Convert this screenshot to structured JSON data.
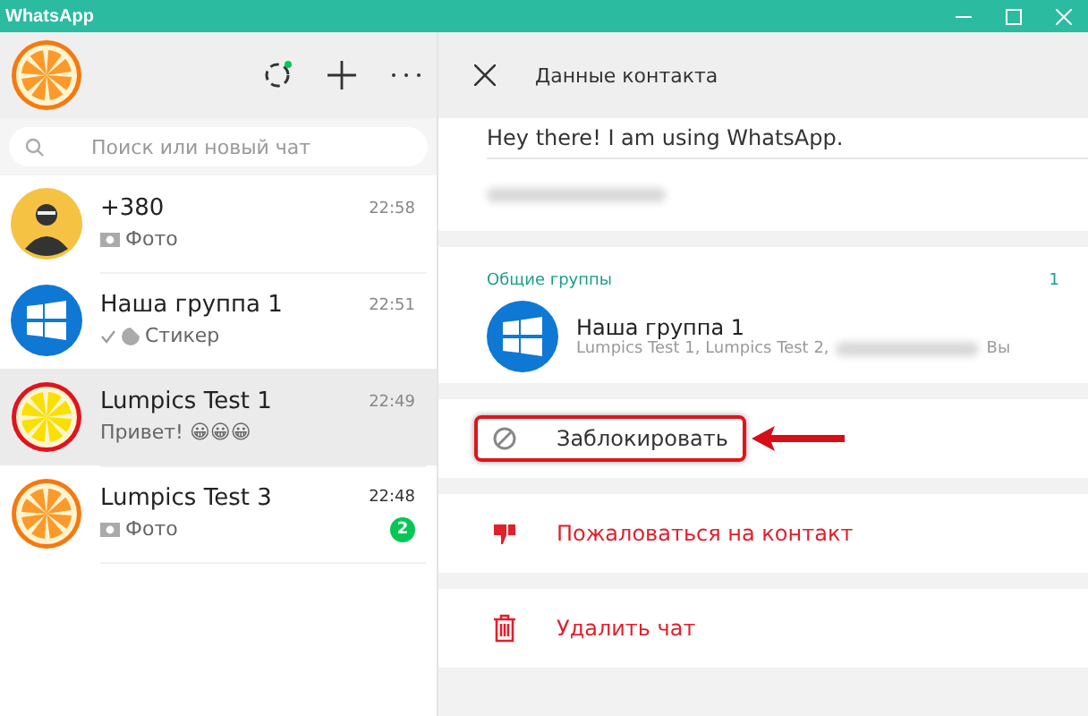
{
  "window": {
    "title": "WhatsApp"
  },
  "sidebar": {
    "search": {
      "placeholder": "Поиск или новый чат"
    },
    "chats": [
      {
        "name": "+380",
        "avatar": {
          "kind": "person"
        },
        "preview_icon": {
          "kind": "photo"
        },
        "preview": "Фото",
        "time": "22:58",
        "selected": false,
        "sent_check": false,
        "bold": false
      },
      {
        "name": "Наша группа 1",
        "avatar": {
          "kind": "windows"
        },
        "preview_icon": {
          "kind": "sticker"
        },
        "preview": "Стикер",
        "time": "22:51",
        "selected": false,
        "sent_check": true,
        "bold": false
      },
      {
        "name": "Lumpics Test 1",
        "avatar": {
          "kind": "lemon"
        },
        "preview": "Привет! 😀😀😀",
        "time": "22:49",
        "selected": true,
        "sent_check": false,
        "bold": false
      },
      {
        "name": "Lumpics Test 3",
        "avatar": {
          "kind": "orange"
        },
        "preview_icon": {
          "kind": "photo"
        },
        "preview": "Фото",
        "time": "22:48",
        "selected": false,
        "sent_check": false,
        "unread": "2",
        "bold": true
      }
    ]
  },
  "contact_panel": {
    "title": "Данные контакта",
    "status": "Hey there! I am using WhatsApp.",
    "common_groups": {
      "heading": "Общие группы",
      "count": "1",
      "groups": [
        {
          "name": "Наша группа 1",
          "members_before": "Lumpics Test 1, Lumpics Test 2,",
          "members_after": "Вы",
          "avatar": {
            "kind": "windows"
          }
        }
      ]
    },
    "actions": [
      {
        "kind": "block",
        "label": "Заблокировать",
        "danger": false,
        "highlighted": true
      },
      {
        "kind": "report",
        "label": "Пожаловаться на контакт",
        "danger": true,
        "highlighted": false
      },
      {
        "kind": "delete",
        "label": "Удалить чат",
        "danger": true,
        "highlighted": false
      }
    ]
  }
}
